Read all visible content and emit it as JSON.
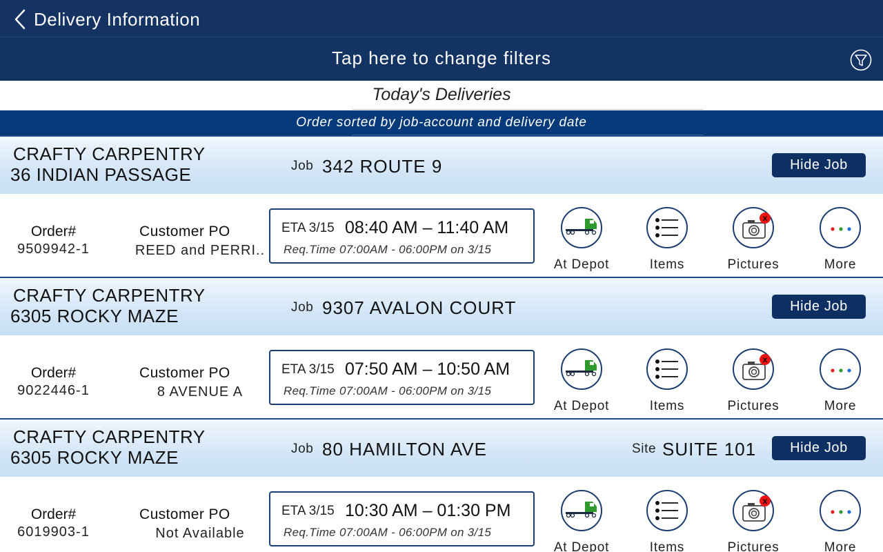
{
  "header": {
    "title": "Delivery Information"
  },
  "filter_bar": {
    "text": "Tap here to change filters"
  },
  "section": {
    "title": "Today's Deliveries",
    "sort_note": "Order sorted by job-account and delivery date"
  },
  "labels": {
    "job": "Job",
    "site": "Site",
    "hide_job": "Hide Job",
    "order": "Order#",
    "customer_po": "Customer PO",
    "eta": "ETA",
    "req_time": "Req.Time",
    "actions": {
      "at_depot": "At Depot",
      "items": "Items",
      "pictures": "Pictures",
      "more": "More"
    }
  },
  "colors": {
    "navy": "#143363",
    "sort_blue": "#053a7a",
    "header_blue": "#d3e6f7",
    "truck_green": "#2e9a2e",
    "badge_red": "#e11111"
  },
  "jobs": [
    {
      "account": "CRAFTY CARPENTRY",
      "address": "36 INDIAN PASSAGE",
      "job": "342 ROUTE 9",
      "site": "",
      "order": "9509942-1",
      "customer_po": "REED and PERRI..",
      "eta_date": "ETA 3/15",
      "eta_window": "08:40 AM – 11:40 AM",
      "req_time": "Req.Time  07:00AM - 06:00PM on 3/15"
    },
    {
      "account": "CRAFTY CARPENTRY",
      "address": "6305 ROCKY MAZE",
      "job": "9307 AVALON COURT",
      "site": "",
      "order": "9022446-1",
      "customer_po": "8 AVENUE A",
      "eta_date": "ETA 3/15",
      "eta_window": "07:50 AM – 10:50 AM",
      "req_time": "Req.Time  07:00AM - 06:00PM on 3/15"
    },
    {
      "account": "CRAFTY CARPENTRY",
      "address": "6305 ROCKY MAZE",
      "job": "80 HAMILTON AVE",
      "site": "SUITE 101",
      "order": "6019903-1",
      "customer_po": "Not Available",
      "eta_date": "ETA 3/15",
      "eta_window": "10:30 AM – 01:30 PM",
      "req_time": "Req.Time  07:00AM - 06:00PM on 3/15"
    }
  ],
  "icons": [
    "back-chevron-icon",
    "filter-icon",
    "truck-icon",
    "list-icon",
    "camera-icon",
    "more-dots-icon",
    "error-x-icon"
  ]
}
